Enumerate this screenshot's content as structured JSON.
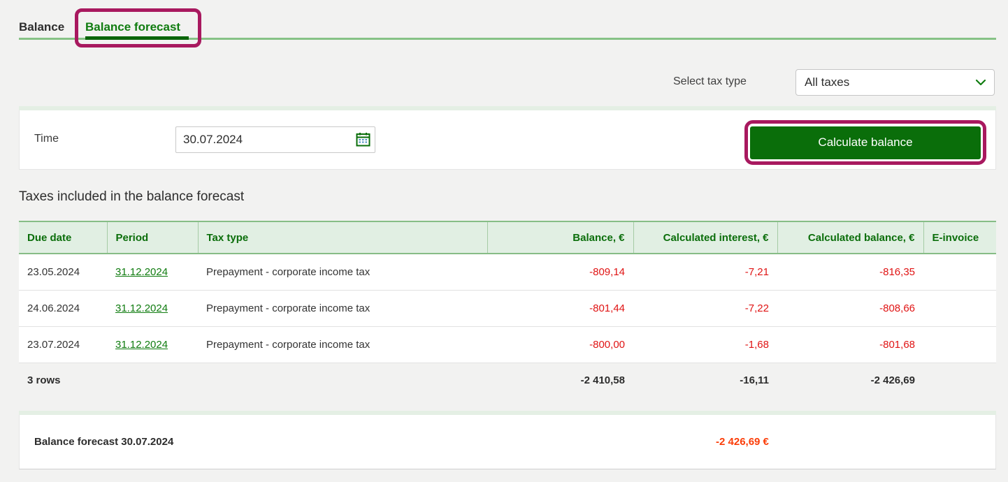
{
  "tabs": [
    {
      "label": "Balance",
      "active": false
    },
    {
      "label": "Balance forecast",
      "active": true
    }
  ],
  "filter": {
    "label": "Select tax type",
    "value": "All taxes"
  },
  "form": {
    "time_label": "Time",
    "time_value": "30.07.2024",
    "button_label": "Calculate balance"
  },
  "section_title": "Taxes included in the balance forecast",
  "table": {
    "columns": [
      "Due date",
      "Period",
      "Tax type",
      "Balance, €",
      "Calculated interest, €",
      "Calculated balance, €",
      "E-invoice"
    ],
    "rows": [
      {
        "due_date": "23.05.2024",
        "period": "31.12.2024",
        "tax_type": "Prepayment - corporate income tax",
        "balance": "-809,14",
        "interest": "-7,21",
        "calculated_balance": "-816,35",
        "e_invoice": ""
      },
      {
        "due_date": "24.06.2024",
        "period": "31.12.2024",
        "tax_type": "Prepayment - corporate income tax",
        "balance": "-801,44",
        "interest": "-7,22",
        "calculated_balance": "-808,66",
        "e_invoice": ""
      },
      {
        "due_date": "23.07.2024",
        "period": "31.12.2024",
        "tax_type": "Prepayment - corporate income tax",
        "balance": "-800,00",
        "interest": "-1,68",
        "calculated_balance": "-801,68",
        "e_invoice": ""
      }
    ],
    "footer": {
      "row_count": "3 rows",
      "balance_total": "-2 410,58",
      "interest_total": "-16,11",
      "calculated_balance_total": "-2 426,69"
    }
  },
  "summary": {
    "label": "Balance forecast 30.07.2024",
    "value": "-2 426,69 €"
  },
  "icons": {
    "calendar": "calendar-icon",
    "chevron": "chevron-down-icon"
  },
  "colors": {
    "accent_green": "#107c10",
    "dark_green": "#0a650a",
    "button_green": "#0a6e0a",
    "light_green_line": "#86c286",
    "header_bg": "#e1efe3",
    "annotation_magenta": "#a8195f",
    "negative_red": "#e01414",
    "total_orange": "#fb3d08",
    "page_bg": "#f2f2f1"
  }
}
